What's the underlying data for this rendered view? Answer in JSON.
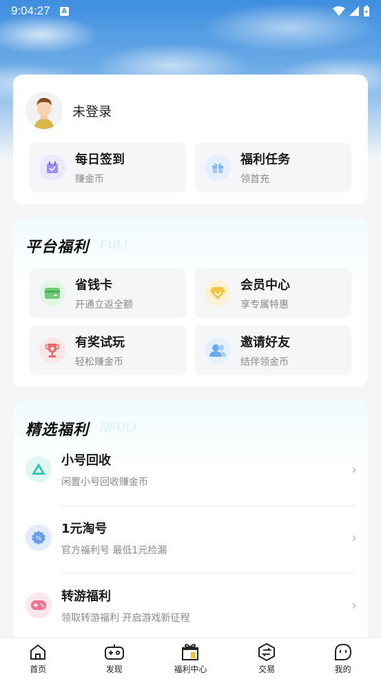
{
  "status_bar": {
    "time": "9:04:27",
    "badge": "A"
  },
  "user": {
    "login_status": "未登录"
  },
  "quick_actions": [
    {
      "title": "每日签到",
      "subtitle": "赚金币",
      "icon": "calendar-check-icon",
      "color": "#8a7cf0"
    },
    {
      "title": "福利任务",
      "subtitle": "领首充",
      "icon": "gift-icon",
      "color": "#5aa5f5"
    }
  ],
  "platform_benefits": {
    "title": "平台福利",
    "ghost": "FULI",
    "items": [
      {
        "title": "省钱卡",
        "subtitle": "开通立返全额",
        "icon": "card-icon",
        "color": "#5cc46a"
      },
      {
        "title": "会员中心",
        "subtitle": "享专属特惠",
        "icon": "diamond-icon",
        "color": "#f5c23a"
      },
      {
        "title": "有奖试玩",
        "subtitle": "轻松赚金币",
        "icon": "trophy-icon",
        "color": "#f06464"
      },
      {
        "title": "邀请好友",
        "subtitle": "结伴领金币",
        "icon": "users-icon",
        "color": "#5aa5f5"
      }
    ]
  },
  "featured_benefits": {
    "title": "精选福利",
    "ghost": "NFULI",
    "items": [
      {
        "title": "小号回收",
        "subtitle": "闲置小号回收赚金币",
        "icon": "recycle-icon",
        "color": "#2fc3b6"
      },
      {
        "title": "1元淘号",
        "subtitle": "官方福利号 最低1元捡漏",
        "icon": "discount-icon",
        "color": "#5a8ff0"
      },
      {
        "title": "转游福利",
        "subtitle": "领取转游福利 开启游戏新征程",
        "icon": "gamepad-icon",
        "color": "#f06a8a"
      }
    ]
  },
  "tabbar": [
    {
      "label": "首页",
      "icon": "home-icon"
    },
    {
      "label": "发现",
      "icon": "gamepad-tab-icon"
    },
    {
      "label": "福利中心",
      "icon": "gift-box-icon",
      "active": true
    },
    {
      "label": "交易",
      "icon": "exchange-icon"
    },
    {
      "label": "我的",
      "icon": "profile-icon"
    }
  ]
}
